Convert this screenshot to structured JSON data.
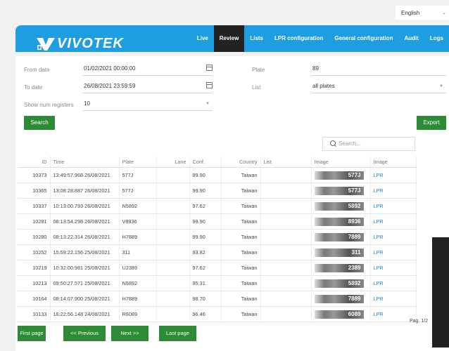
{
  "language": {
    "value": "English"
  },
  "brand": {
    "logo_text": "VIVOTEK"
  },
  "nav": [
    "Live",
    "Review",
    "Lists",
    "LPR configuration",
    "General configuration",
    "Audit",
    "Logs"
  ],
  "nav_active": "Review",
  "filters": {
    "from_date_label": "From date",
    "from_date_value": "01/02/2021 00:00:00",
    "to_date_label": "To date",
    "to_date_value": "26/08/2021 23:59:59",
    "num_label": "Show num registers",
    "num_value": "10",
    "plate_label": "Plate",
    "plate_value": "89",
    "list_label": "List",
    "list_value": "all plates"
  },
  "buttons": {
    "search": "Search",
    "export": "Export"
  },
  "search": {
    "placeholder": "Search..."
  },
  "table": {
    "headers": [
      "ID",
      "Time",
      "Plate",
      "Lane",
      "Conf.",
      "Country",
      "List",
      "Image",
      "Image"
    ],
    "rows": [
      {
        "id": "10373",
        "time": "13:49:57.968 26/08/2021",
        "plate": "577J",
        "conf": "99.90",
        "country": "Taiwan",
        "img": "577J",
        "link": "LPR"
      },
      {
        "id": "10365",
        "time": "13:08:28.887 26/08/2021",
        "plate": "577J",
        "conf": "99.90",
        "country": "Taiwan",
        "img": "577J",
        "link": "LPR"
      },
      {
        "id": "10337",
        "time": "10:13:00.793 26/08/2021",
        "plate": "N5892",
        "conf": "97.62",
        "country": "Taiwan",
        "img": "5892",
        "link": "LPR"
      },
      {
        "id": "10281",
        "time": "08:13:54.298 26/08/2021",
        "plate": "V8936",
        "conf": "99.90",
        "country": "Taiwan",
        "img": "8936",
        "link": "LPR"
      },
      {
        "id": "10280",
        "time": "08:13:22.314 26/08/2021",
        "plate": "H7889",
        "conf": "99.90",
        "country": "Taiwan",
        "img": "7889",
        "link": "LPR"
      },
      {
        "id": "10252",
        "time": "15:59:22.156 25/08/2021",
        "plate": "311",
        "conf": "93.82",
        "country": "Taiwan",
        "img": "311",
        "link": "LPR"
      },
      {
        "id": "10219",
        "time": "10:32:00.981 25/08/2021",
        "plate": "U2389",
        "conf": "97.62",
        "country": "Taiwan",
        "img": "2389",
        "link": "LPR"
      },
      {
        "id": "10213",
        "time": "09:50:27.571 25/08/2021",
        "plate": "N5892",
        "conf": "95.31",
        "country": "Taiwan",
        "img": "5892",
        "link": "LPR"
      },
      {
        "id": "10164",
        "time": "08:14:07.900 25/08/2021",
        "plate": "H7889",
        "conf": "98.70",
        "country": "Taiwan",
        "img": "7889",
        "link": "LPR"
      },
      {
        "id": "10133",
        "time": "16:22:56.148 24/08/2021",
        "plate": "R6089",
        "conf": "96.46",
        "country": "Taiwan",
        "img": "6089",
        "link": "LPR"
      }
    ]
  },
  "pagination": {
    "label": "Pag. 1/2",
    "first": "First page",
    "prev": "<< Previous",
    "next": "Next >>",
    "last": "Last page"
  }
}
